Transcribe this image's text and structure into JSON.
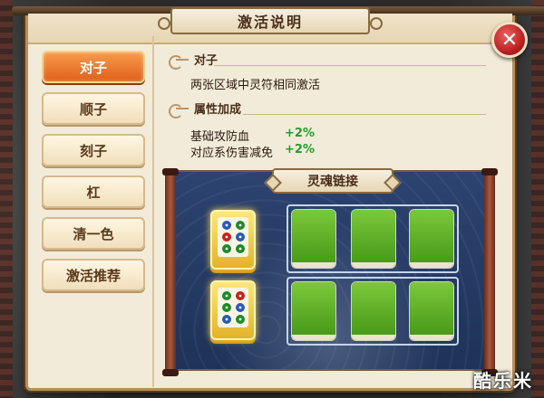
{
  "dialog": {
    "title": "激活说明",
    "close_symbol": "✕"
  },
  "sidebar": {
    "items": [
      {
        "label": "对子",
        "active": true
      },
      {
        "label": "顺子",
        "active": false
      },
      {
        "label": "刻子",
        "active": false
      },
      {
        "label": "杠",
        "active": false
      },
      {
        "label": "清一色",
        "active": false
      },
      {
        "label": "激活推荐",
        "active": false
      }
    ]
  },
  "content": {
    "section1_title": "对子",
    "description": "两张区域中灵符相同激活",
    "section2_title": "属性加成",
    "stats": [
      {
        "name": "基础攻防血",
        "value": "+2%"
      },
      {
        "name": "对应系伤害减免",
        "value": "+2%"
      }
    ]
  },
  "board": {
    "title": "灵魂链接",
    "filled_slots": 2,
    "empty_slots": 6
  },
  "watermark": "酷乐米",
  "colors": {
    "active_tab": "#e0601c",
    "stat_positive": "#1fa02a",
    "empty_tile": "#5aac24",
    "board_bg": "#24395f"
  }
}
